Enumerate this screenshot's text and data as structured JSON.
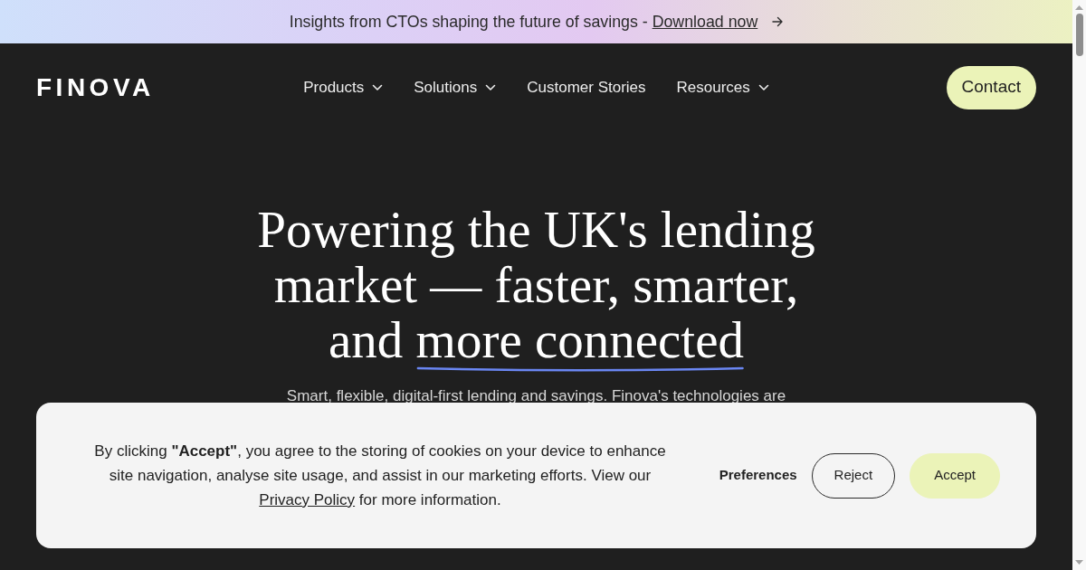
{
  "announcement": {
    "text": "Insights from CTOs shaping the future of savings -",
    "link": "Download now"
  },
  "header": {
    "logo": "FINOVA",
    "nav": [
      {
        "label": "Products",
        "dropdown": true
      },
      {
        "label": "Solutions",
        "dropdown": true
      },
      {
        "label": "Customer Stories",
        "dropdown": false
      },
      {
        "label": "Resources",
        "dropdown": true
      }
    ],
    "contact_button": "Contact"
  },
  "hero": {
    "heading": "Powering the UK's lending market — faster, smarter, and",
    "heading_highlight": "more connected",
    "subtitle": "Smart, flexible, digital-first lending and savings. Finova's technologies are"
  },
  "cookie_banner": {
    "text_before": "By clicking **\"Accept\"**, you agree to the storing of cookies on your device to enhance site navigation, analyse site usage, and assist in our marketing efforts. View our",
    "link": "Privacy Policy",
    "text_after": "for more information.",
    "buttons": [
      {
        "label": "Preferences",
        "kind": "text"
      },
      {
        "label": "Reject",
        "kind": "outline"
      },
      {
        "label": "Accept",
        "kind": "filled"
      }
    ]
  }
}
